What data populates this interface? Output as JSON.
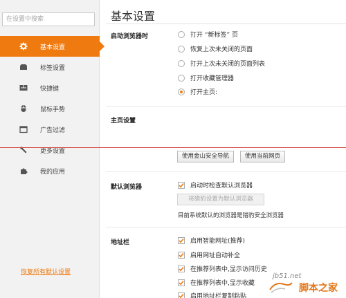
{
  "sidebar": {
    "search_placeholder": "在设置中搜索",
    "items": [
      {
        "label": "基本设置",
        "icon": "gear-icon"
      },
      {
        "label": "标签设置",
        "icon": "tab-icon"
      },
      {
        "label": "快捷键",
        "icon": "keyboard-icon"
      },
      {
        "label": "鼠标手势",
        "icon": "mouse-icon"
      },
      {
        "label": "广告过滤",
        "icon": "window-icon"
      },
      {
        "label": "更多设置",
        "icon": "wrench-icon"
      },
      {
        "label": "我的应用",
        "icon": "puzzle-icon"
      }
    ],
    "restore_link": "恢复所有默认设置"
  },
  "main": {
    "title": "基本设置",
    "startup": {
      "label": "启动浏览器时",
      "options": [
        "打开 “新标签” 页",
        "恢复上次未关闭的页面",
        "打开上次未关闭的页面列表",
        "打开收藏管理器",
        "打开主页:"
      ]
    },
    "homepage": {
      "label": "主页设置",
      "btn_safe_nav": "使用金山安全导航",
      "btn_current": "使用当前网页"
    },
    "default_browser": {
      "label": "默认浏览器",
      "check_label": "启动时检查默认浏览器",
      "set_default_btn": "将猎豹设置为默认浏览器",
      "status": "目前系统默认的浏览器是猎豹安全浏览器"
    },
    "address_bar": {
      "label": "地址栏",
      "options": [
        "启用智能网址(推荐)",
        "启用网址自动补全",
        "在推荐列表中,显示访问历史",
        "在推荐列表中,显示收藏",
        "启用地址栏复制粘贴"
      ]
    }
  },
  "watermark": {
    "site": "jb51.net",
    "name": "脚本之家"
  },
  "colors": {
    "accent": "#ef7a10",
    "sidebar_bg": "#f2f2f2",
    "red_line": "#d4463f"
  }
}
